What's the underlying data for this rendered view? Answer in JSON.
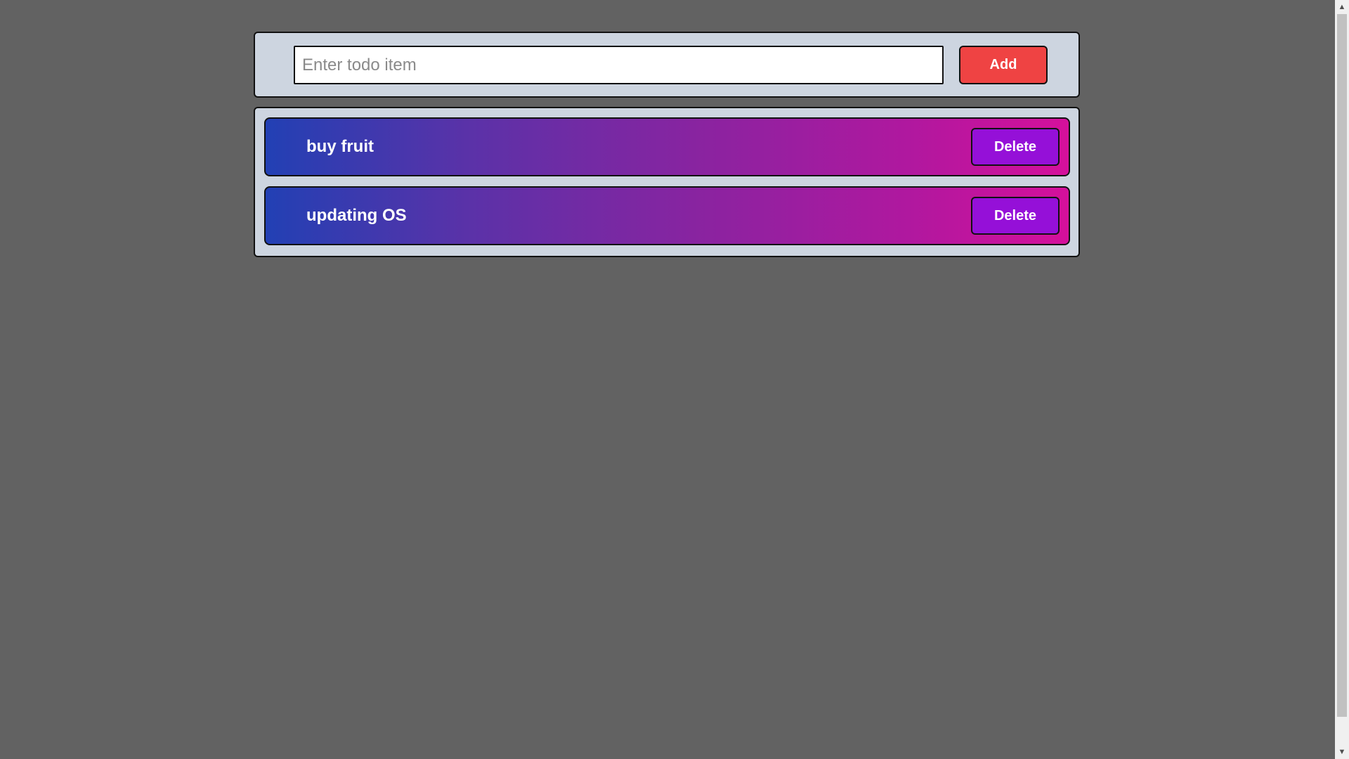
{
  "input": {
    "placeholder": "Enter todo item",
    "value": ""
  },
  "add_button": {
    "label": "Add"
  },
  "todos": [
    {
      "text": "buy fruit",
      "delete_label": "Delete"
    },
    {
      "text": "updating OS",
      "delete_label": "Delete"
    }
  ],
  "colors": {
    "background": "#626262",
    "panel": "#cdd5e0",
    "add_button": "#ef4343",
    "delete_button": "#9510d8",
    "item_gradient_start": "#2240b4",
    "item_gradient_end": "#d5109b"
  },
  "scrollbar": {
    "up_icon": "▲",
    "down_icon": "▼"
  }
}
